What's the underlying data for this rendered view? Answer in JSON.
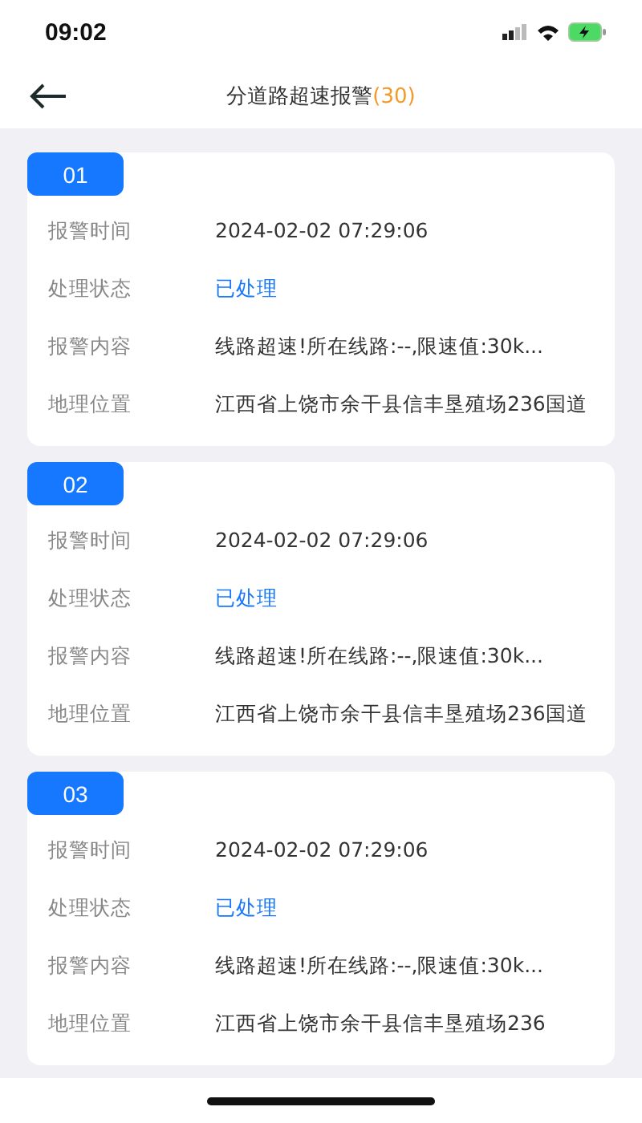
{
  "status_bar": {
    "time": "09:02"
  },
  "header": {
    "title": "分道路超速报警",
    "count": "(30)"
  },
  "alarms": [
    {
      "number": "01",
      "fields": [
        {
          "label": "报警时间",
          "value": "2024-02-02 07:29:06",
          "kind": "text"
        },
        {
          "label": "处理状态",
          "value": "已处理",
          "kind": "status"
        },
        {
          "label": "报警内容",
          "value": "线路超速!所在线路:--,限速值:30k...",
          "kind": "text"
        },
        {
          "label": "地理位置",
          "value": "江西省上饶市余干县信丰垦殖场236国道",
          "kind": "text"
        }
      ]
    },
    {
      "number": "02",
      "fields": [
        {
          "label": "报警时间",
          "value": "2024-02-02 07:29:06",
          "kind": "text"
        },
        {
          "label": "处理状态",
          "value": "已处理",
          "kind": "status"
        },
        {
          "label": "报警内容",
          "value": "线路超速!所在线路:--,限速值:30k...",
          "kind": "text"
        },
        {
          "label": "地理位置",
          "value": "江西省上饶市余干县信丰垦殖场236国道",
          "kind": "text"
        }
      ]
    },
    {
      "number": "03",
      "fields": [
        {
          "label": "报警时间",
          "value": "2024-02-02 07:29:06",
          "kind": "text"
        },
        {
          "label": "处理状态",
          "value": "已处理",
          "kind": "status"
        },
        {
          "label": "报警内容",
          "value": "线路超速!所在线路:--,限速值:30k...",
          "kind": "text"
        },
        {
          "label": "地理位置",
          "value": "江西省上饶市余干县信丰垦殖场236",
          "kind": "text"
        }
      ]
    }
  ]
}
